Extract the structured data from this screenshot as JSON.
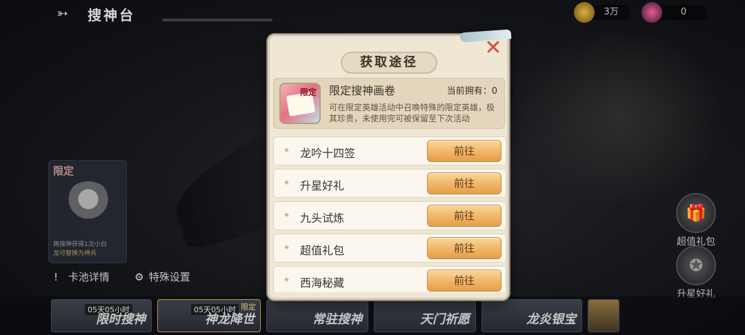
{
  "header": {
    "title": "搜神台",
    "gold": "3万",
    "gems": "0"
  },
  "hero_card": {
    "tag": "限定",
    "hint_line1": "再搜神获得1次小白",
    "hint_line2": "龙可替换为神兵"
  },
  "bottom_left": {
    "pool_details": "卡池详情",
    "special_settings": "特殊设置"
  },
  "side": {
    "gift": "超值礼包",
    "star": "升星好礼"
  },
  "tabs": [
    {
      "label": "限时搜神",
      "timer": "05天05小时"
    },
    {
      "label": "神龙降世",
      "timer": "05天05小时",
      "badge": "限定"
    },
    {
      "label": "常驻搜神"
    },
    {
      "label": "天门祈愿"
    },
    {
      "label": "龙炎银宝"
    },
    {
      "label": ""
    }
  ],
  "modal": {
    "title": "获取途径",
    "item": {
      "name": "限定搜神画卷",
      "owned": "当前拥有：0",
      "icon_tag": "限定",
      "description": "可在限定英雄活动中召唤特殊的限定英雄，极其珍贵，未使用完可被保留至下次活动"
    },
    "go_label": "前往",
    "sources": [
      {
        "label": "龙吟十四签"
      },
      {
        "label": "升星好礼"
      },
      {
        "label": "九头试炼"
      },
      {
        "label": "超值礼包"
      },
      {
        "label": "西海秘藏"
      }
    ]
  }
}
